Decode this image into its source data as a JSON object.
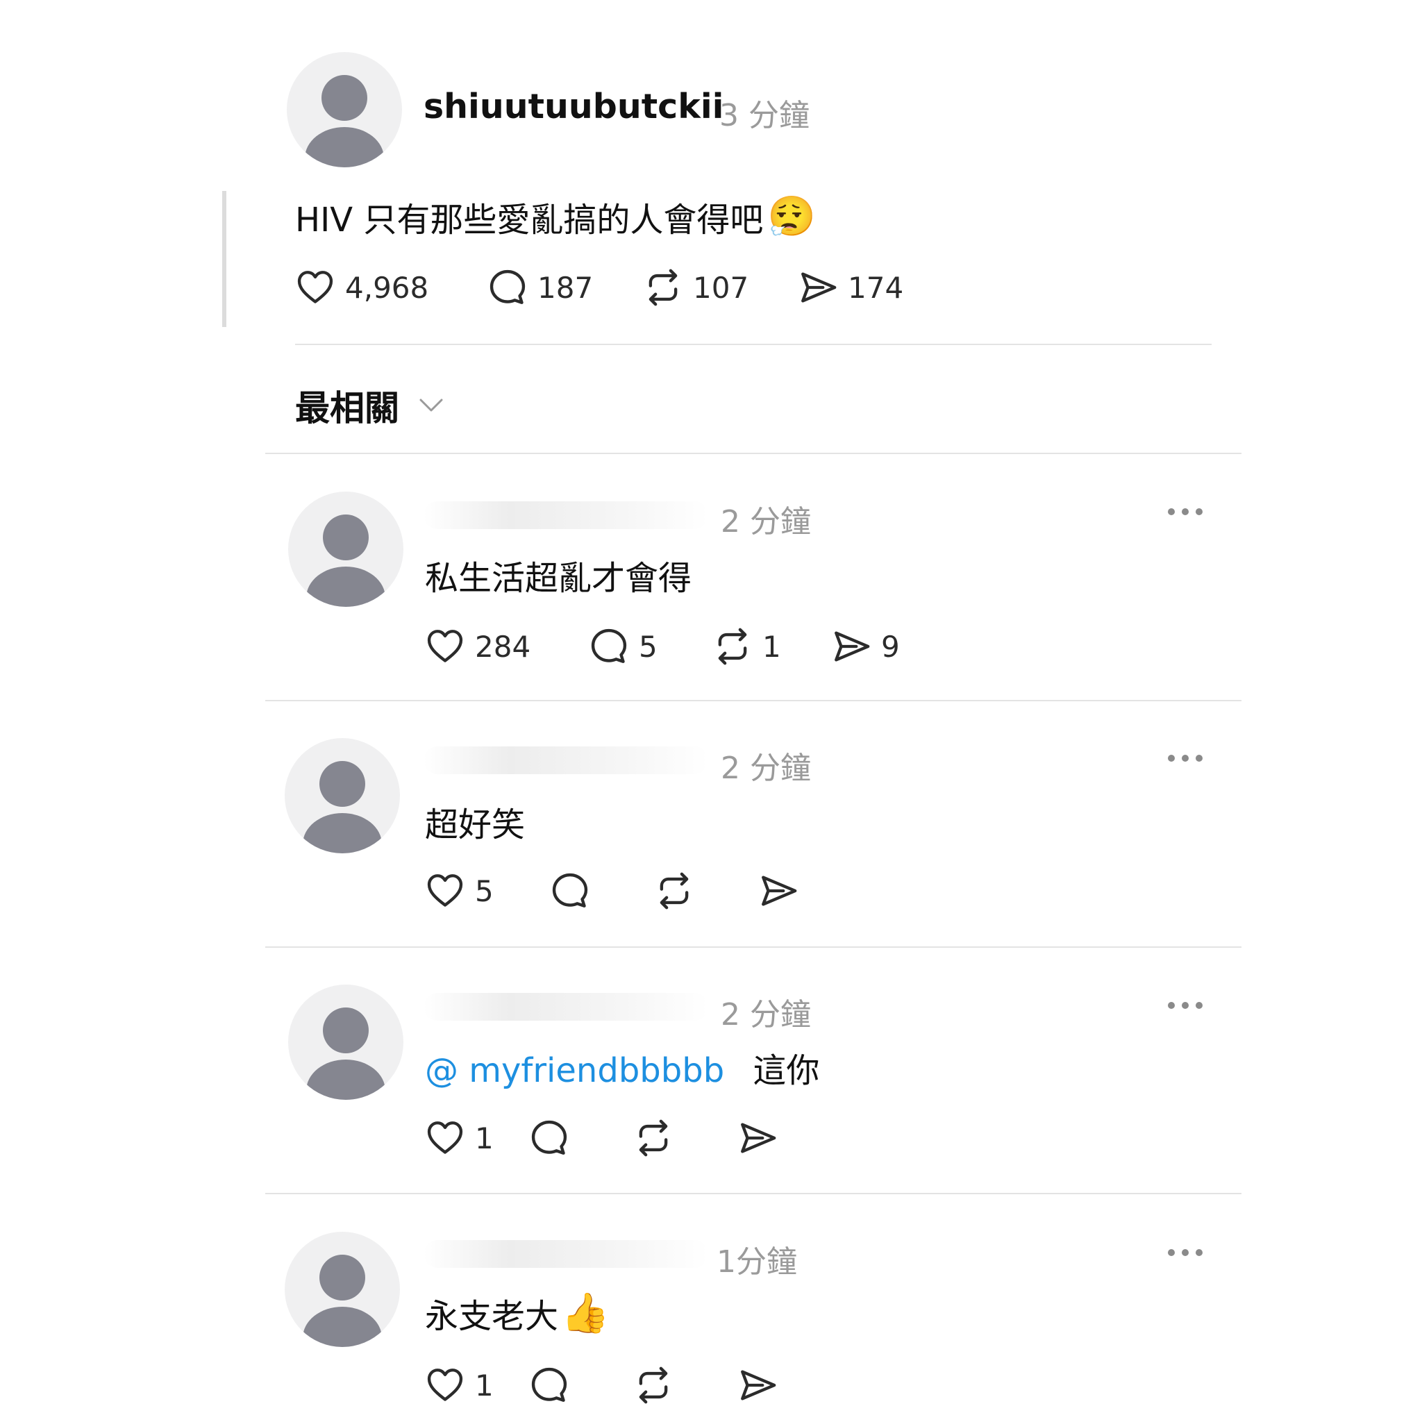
{
  "post": {
    "username": "shiuutuubutckii",
    "time": "3 分鐘",
    "text": "HIV 只有那些愛亂搞的人會得吧",
    "emoji": "😮‍💨",
    "likes": "4,968",
    "comments": "187",
    "reposts": "107",
    "shares": "174"
  },
  "sort": {
    "label": "最相關"
  },
  "replies": [
    {
      "time": "2 分鐘",
      "text": "私生活超亂才會得",
      "likes": "284",
      "comments": "5",
      "reposts": "1",
      "shares": "9"
    },
    {
      "time": "2 分鐘",
      "text": "超好笑",
      "likes": "5"
    },
    {
      "time": "2 分鐘",
      "mention": "@ myfriendbbbbb",
      "text": "這你",
      "likes": "1"
    },
    {
      "time": "1分鐘",
      "text": "永支老大",
      "emoji": "👍",
      "likes": "1"
    }
  ],
  "icons": {
    "like": "heart-icon",
    "comment": "comment-bubble-icon",
    "repost": "repost-icon",
    "share": "send-icon",
    "more": "more-dots-icon",
    "sort": "chevron-down-icon"
  },
  "colors": {
    "mention": "#1d8fe0",
    "timestamp": "#9a9a9a",
    "avatar": "#858690"
  }
}
